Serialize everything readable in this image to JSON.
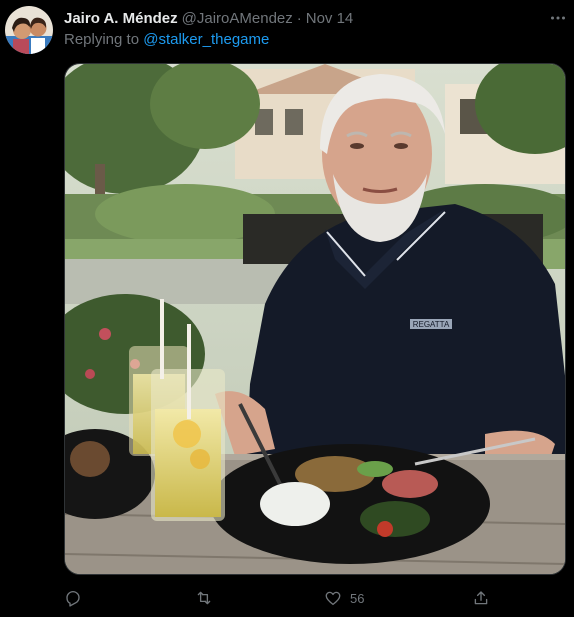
{
  "tweet": {
    "author": {
      "display_name": "Jairo A. Méndez",
      "handle": "@JairoAMendez",
      "avatar_icon": "avatar-photo"
    },
    "separator": "·",
    "timestamp": "Nov 14",
    "reply_prefix": "Replying to ",
    "reply_to": "@stalker_thegame",
    "media": {
      "kind": "photo",
      "shirt_logo": "REGATTA"
    },
    "actions": {
      "reply_icon": "reply-icon",
      "retweet_icon": "retweet-icon",
      "like_icon": "heart-icon",
      "like_count": "56",
      "share_icon": "share-icon"
    }
  },
  "colors": {
    "background": "#000000",
    "text_primary": "#e7e9ea",
    "text_secondary": "#71767b",
    "link": "#1d9bf0",
    "border": "#2f3336"
  }
}
